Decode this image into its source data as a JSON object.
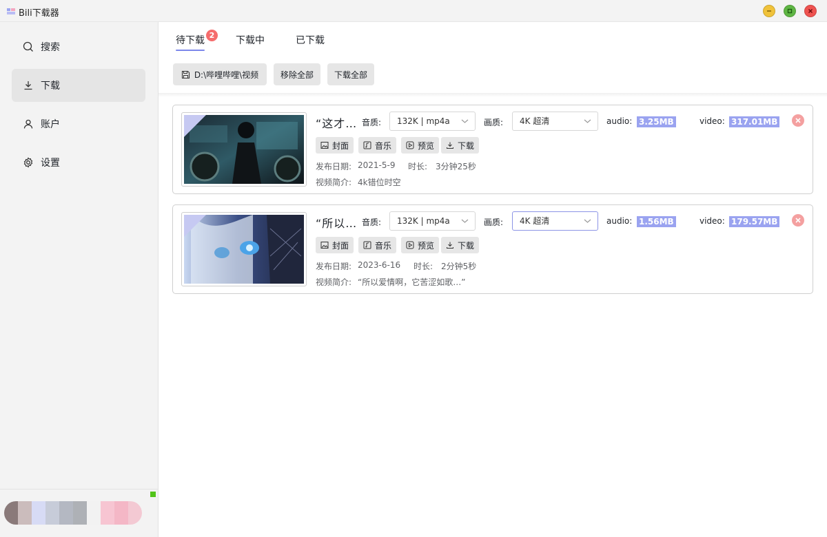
{
  "window": {
    "title": "Bili下载器",
    "colors": {
      "minimize": "#f0c23a",
      "maximize": "#5fb644",
      "close": "#ef5350"
    }
  },
  "sidebar": {
    "items": [
      {
        "label": "搜索",
        "icon": "search-icon"
      },
      {
        "label": "下载",
        "icon": "download-icon",
        "active": true
      },
      {
        "label": "账户",
        "icon": "user-icon"
      },
      {
        "label": "设置",
        "icon": "gear-icon"
      }
    ],
    "status_color": "#52c41a"
  },
  "tabs": {
    "items": [
      {
        "label": "待下载",
        "active": true
      },
      {
        "label": "下载中"
      },
      {
        "label": "已下载"
      }
    ],
    "badge": "2"
  },
  "toolbar": {
    "path_label": "D:\\哔哩哔哩\\视频",
    "remove_all": "移除全部",
    "download_all": "下载全部"
  },
  "labels": {
    "audio_quality": "音质:",
    "video_quality": "画质:",
    "audio_size": "audio:",
    "video_size": "video:",
    "cover": "封面",
    "music": "音乐",
    "preview": "预览",
    "download": "下载",
    "publish_date": "发布日期:",
    "duration": "时长:",
    "intro": "视频简介:"
  },
  "videos": [
    {
      "title": "“这才…",
      "audio": "132K | mp4a",
      "quality": "4K 超清",
      "audio_size": "3.25MB",
      "video_size": "317.01MB",
      "date": "2021-5-9",
      "duration": "3分钟25秒",
      "intro": "4k错位时空"
    },
    {
      "title": "“所以…",
      "audio": "132K | mp4a",
      "quality": "4K 超清",
      "audio_size": "1.56MB",
      "video_size": "179.57MB",
      "date": "2023-6-16",
      "duration": "2分钟5秒",
      "intro": "“所以爱情啊，它苦涩如歌…”"
    }
  ],
  "accent": "#9aa3f0"
}
